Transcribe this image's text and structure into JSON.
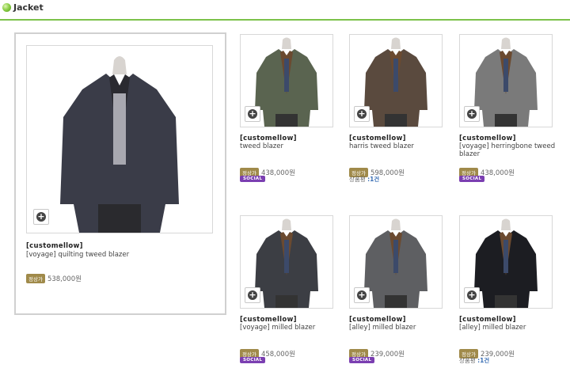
{
  "section": {
    "title": "Jacket"
  },
  "price_tag_label": "정상가",
  "social_label": "SOCIAL",
  "stock_label": "상품평",
  "featured": {
    "brand": "[customellow]",
    "name": "[voyage] quilting tweed blazer",
    "price": "538,000원",
    "jacket_color": "#3a3c48"
  },
  "products": [
    {
      "brand": "[customellow]",
      "name": "tweed blazer",
      "price": "438,000원",
      "social": true,
      "stock": "",
      "jacket_color": "#5a6450"
    },
    {
      "brand": "[customellow]",
      "name": "harris tweed blazer",
      "price": "598,000원",
      "social": false,
      "stock": ":1건",
      "jacket_color": "#5a4a3e"
    },
    {
      "brand": "[customellow]",
      "name": "[voyage] herringbone tweed blazer",
      "price": "438,000원",
      "social": true,
      "stock": "",
      "jacket_color": "#7a7a7a"
    },
    {
      "brand": "[customellow]",
      "name": "[voyage] milled blazer",
      "price": "458,000원",
      "social": true,
      "stock": "",
      "jacket_color": "#3c3e44"
    },
    {
      "brand": "[customellow]",
      "name": "[alley] milled blazer",
      "price": "239,000원",
      "social": true,
      "stock": "",
      "jacket_color": "#5e5f62"
    },
    {
      "brand": "[customellow]",
      "name": "[alley] milled blazer",
      "price": "239,000원",
      "social": false,
      "stock": ":1건",
      "jacket_color": "#1c1d22"
    }
  ]
}
